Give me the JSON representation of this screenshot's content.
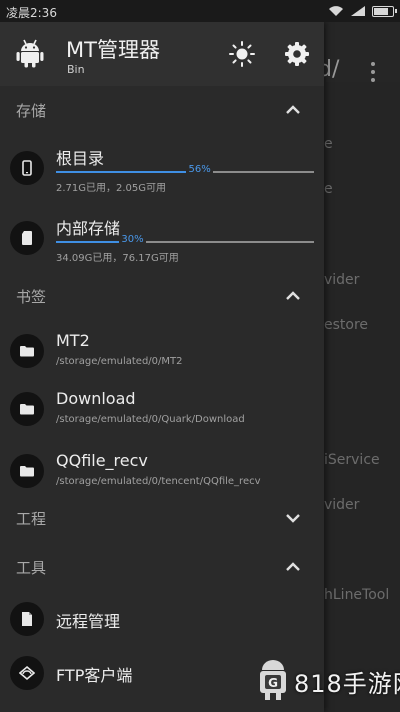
{
  "status_bar": {
    "time": "凌晨2:36"
  },
  "background_app": {
    "path_fragment": "d/",
    "rows": [
      "e",
      "e",
      "vider",
      "estore",
      "iService",
      "vider",
      "hLineTool"
    ]
  },
  "drawer": {
    "title": "MT管理器",
    "subtitle": "Bin",
    "sections": [
      {
        "title": "存储",
        "expanded": true,
        "items": [
          {
            "title": "根目录",
            "percent_label": "56%",
            "percent": 56,
            "detail": "2.71G已用，2.05G可用",
            "icon": "phone-icon"
          },
          {
            "title": "内部存储",
            "percent_label": "30%",
            "percent": 30,
            "detail": "34.09G已用，76.17G可用",
            "icon": "sd-card-icon"
          }
        ]
      },
      {
        "title": "书签",
        "expanded": true,
        "items": [
          {
            "title": "MT2",
            "detail": "/storage/emulated/0/MT2",
            "icon": "folder-icon"
          },
          {
            "title": "Download",
            "detail": "/storage/emulated/0/Quark/Download",
            "icon": "folder-icon"
          },
          {
            "title": "QQfile_recv",
            "detail": "/storage/emulated/0/tencent/QQfile_recv",
            "icon": "folder-icon"
          }
        ]
      },
      {
        "title": "工程",
        "expanded": false,
        "items": []
      },
      {
        "title": "工具",
        "expanded": true,
        "items": [
          {
            "title": "远程管理",
            "icon": "file-icon"
          },
          {
            "title": "FTP客户端",
            "icon": "ftp-icon"
          }
        ]
      }
    ]
  },
  "watermark": {
    "text": "818手游网",
    "badge": "G"
  },
  "colors": {
    "accent": "#3f8fe4",
    "drawer_bg": "#2a2a2a",
    "header_bg": "#303030"
  }
}
